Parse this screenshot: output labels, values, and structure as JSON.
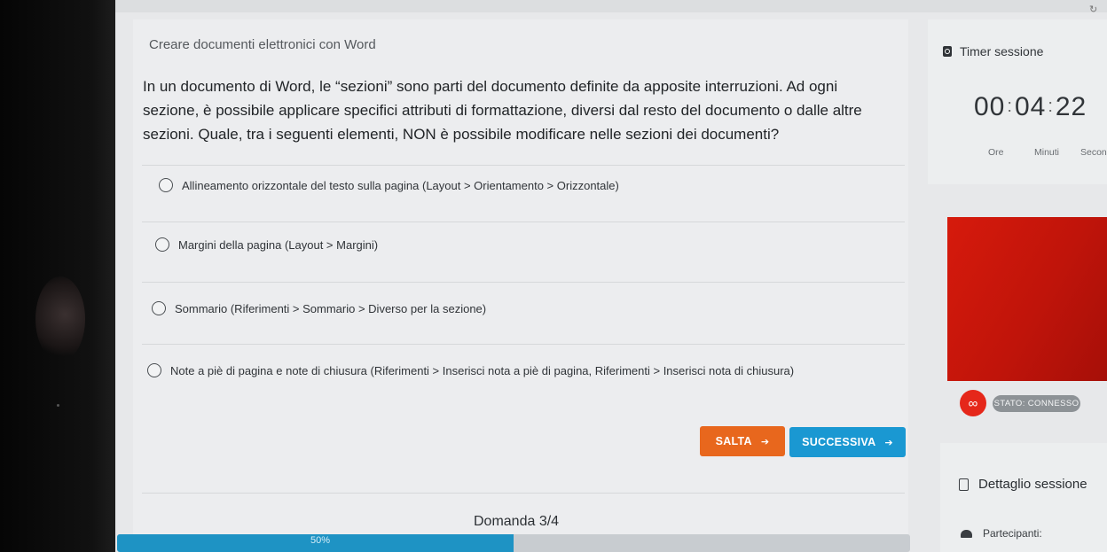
{
  "course_title": "Creare documenti elettronici con Word",
  "question_text": "In un documento di Word, le “sezioni” sono parti del documento definite da apposite interruzioni. Ad ogni sezione, è possibile applicare specifici attributi di formattazione, diversi dal resto del documento o dalle altre sezioni. Quale, tra i seguenti elementi, NON è possibile modificare nelle sezioni dei documenti?",
  "options": [
    {
      "label": "Allineamento orizzontale del testo sulla pagina (Layout > Orientamento > Orizzontale)",
      "selected": false
    },
    {
      "label": "Margini della pagina (Layout > Margini)",
      "selected": false
    },
    {
      "label": "Sommario (Riferimenti > Sommario > Diverso per la sezione)",
      "selected": false
    },
    {
      "label": "Note a piè di pagina e note di chiusura (Riferimenti > Inserisci nota a piè di pagina, Riferimenti > Inserisci nota di chiusura)",
      "selected": false
    }
  ],
  "buttons": {
    "skip_label": "SALTA",
    "next_label": "SUCCESSIVA"
  },
  "progress": {
    "question_counter": "Domanda 3/4",
    "percent_label": "50%",
    "fraction": 0.5
  },
  "timer": {
    "title": "Timer sessione",
    "hours": "00",
    "minutes": "04",
    "seconds": "22",
    "unit_hours": "Ore",
    "unit_minutes": "Minuti",
    "unit_seconds": "Secondi"
  },
  "status": {
    "label": "STATO: CONNESSO"
  },
  "session_detail": {
    "title": "Dettaglio sessione",
    "participants_label": "Partecipanti:"
  },
  "icons": {
    "timer": "clock-icon",
    "link": "link-icon",
    "detail": "document-icon",
    "participants": "users-icon",
    "window": "refresh-icon"
  },
  "colors": {
    "skip": "#e8671d",
    "next": "#1a98d2",
    "progress": "#1e93c4",
    "status": "#8d9296",
    "link": "#e5271a"
  }
}
